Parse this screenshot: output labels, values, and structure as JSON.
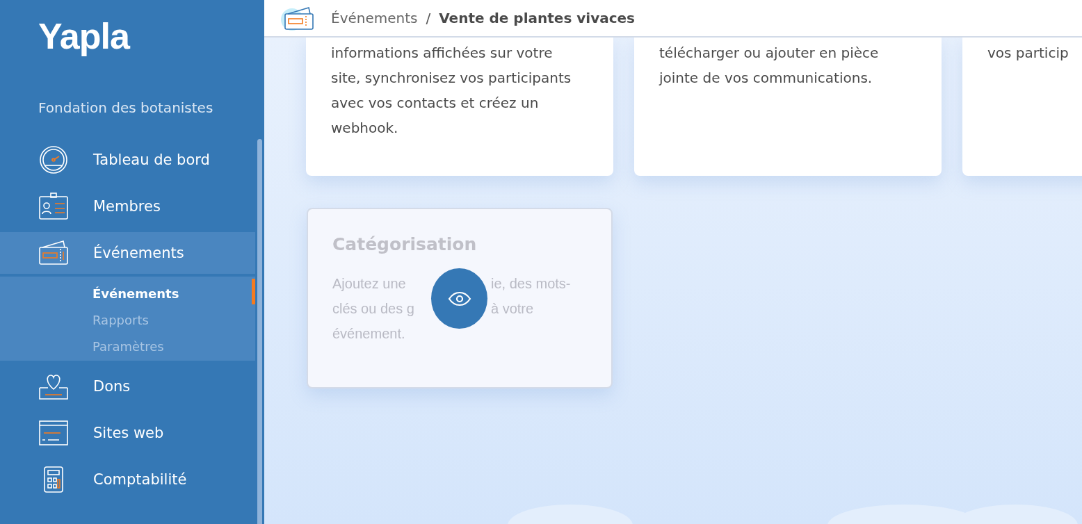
{
  "sidebar": {
    "logo": "Yapla",
    "organization": "Fondation des botanistes",
    "items": [
      {
        "kind": "dashboard",
        "label": "Tableau de bord",
        "selected": false
      },
      {
        "kind": "members",
        "label": "Membres",
        "selected": false
      },
      {
        "kind": "events",
        "label": "Événements",
        "selected": true,
        "expanded": true,
        "children": [
          {
            "label": "Événements",
            "selected": true
          },
          {
            "label": "Rapports",
            "selected": false
          },
          {
            "label": "Paramètres",
            "selected": false
          }
        ]
      },
      {
        "kind": "donations",
        "label": "Dons",
        "selected": false
      },
      {
        "kind": "websites",
        "label": "Sites web",
        "selected": false
      },
      {
        "kind": "accounting",
        "label": "Comptabilité",
        "selected": false
      }
    ]
  },
  "header": {
    "breadcrumb": [
      {
        "label": "Événements",
        "current": false
      },
      {
        "label": "Vente de plantes vivaces",
        "current": true
      }
    ],
    "separator": "/"
  },
  "cards": [
    {
      "description": "informations affichées sur votre site, synchronisez vos participants avec vos contacts et créez un webhook.",
      "disabled": false
    },
    {
      "description": "télécharger ou ajouter en pièce jointe de vos communications.",
      "disabled": false
    },
    {
      "description": "vos particip",
      "disabled": false
    }
  ],
  "second_row": [
    {
      "title": "Catégorisation",
      "description_lines": [
        [
          "Ajoutez une",
          "ie, des mots-"
        ],
        [
          "clés ou des g",
          "à votre"
        ],
        [
          "événement."
        ]
      ],
      "disabled": true
    }
  ]
}
